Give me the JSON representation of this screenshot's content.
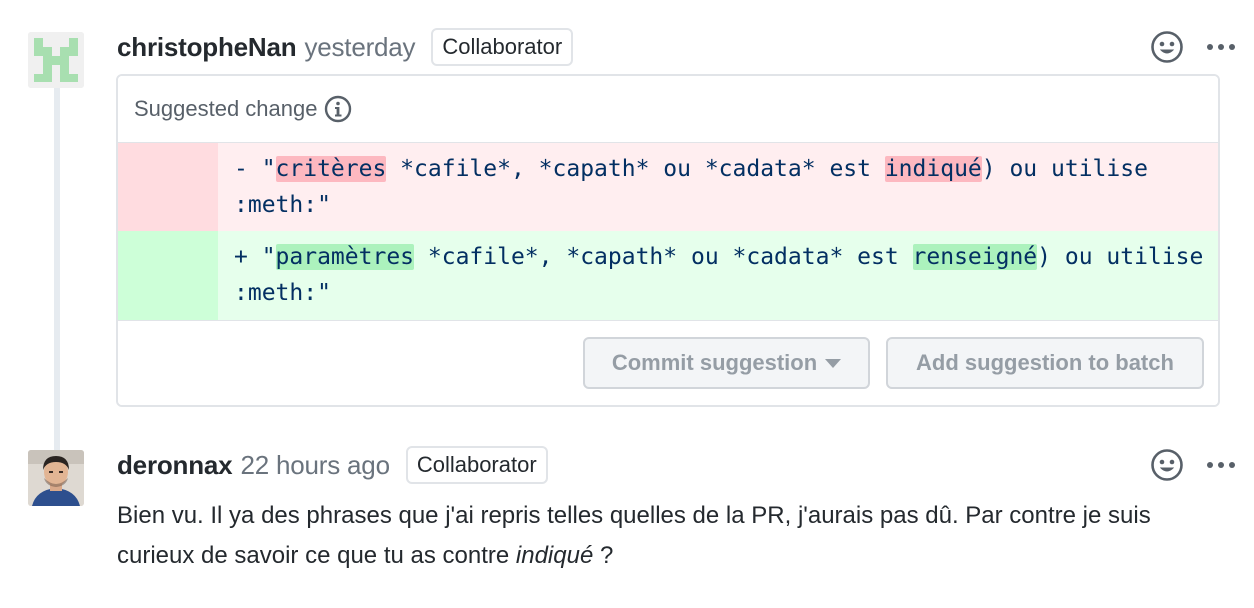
{
  "comments": [
    {
      "author": "christopheNan",
      "time": "yesterday",
      "badge": "Collaborator",
      "suggestion": {
        "title": "Suggested change",
        "deleted": {
          "prefix": "- \"",
          "hl1": "critères",
          "mid": " *cafile*, *capath* ou *cadata* est ",
          "hl2": "indiqué",
          "suffix": ") ou utilise :meth:\""
        },
        "added": {
          "prefix": "+ \"",
          "hl1": "paramètres",
          "mid": " *cafile*, *capath* ou *cadata* est ",
          "hl2": "renseigné",
          "suffix": ") ou utilise :meth:\""
        },
        "commit_label": "Commit suggestion",
        "batch_label": "Add suggestion to batch"
      }
    },
    {
      "author": "deronnax",
      "time": "22 hours ago",
      "badge": "Collaborator",
      "body_start": "Bien vu. Il ya des phrases que j'ai repris telles quelles de la PR, j'aurais pas dû. Par contre je suis curieux de savoir ce que tu as contre ",
      "body_em": "indiqué",
      "body_end": " ?"
    }
  ],
  "icons": {
    "reaction": "smiley-icon",
    "more": "kebab-horizontal-icon",
    "info": "info-icon",
    "caret": "triangle-down-icon"
  },
  "colors": {
    "deleted_bg": "#ffeef0",
    "added_bg": "#e6ffec",
    "deleted_highlight": "#fdb8c0",
    "added_highlight": "#acf2bd"
  }
}
